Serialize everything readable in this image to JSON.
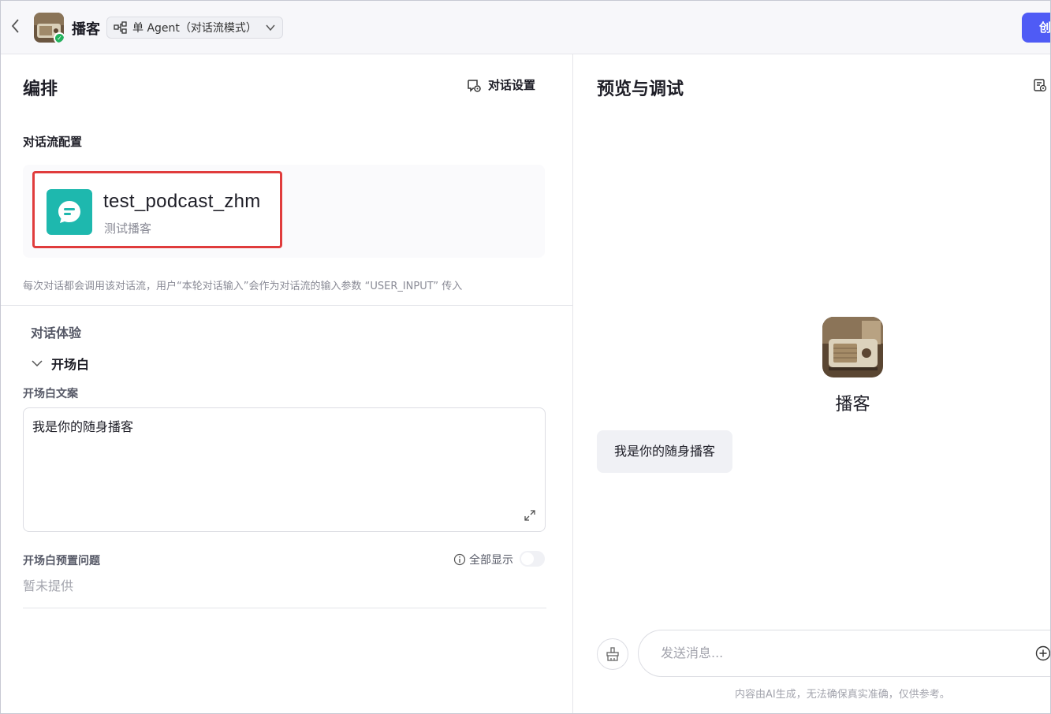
{
  "header": {
    "bot_name": "播客",
    "mode_label": "单 Agent（对话流模式）",
    "create_label": "创"
  },
  "left": {
    "title": "编排",
    "chat_settings_label": "对话设置",
    "flow_config_label": "对话流配置",
    "flow": {
      "name": "test_podcast_zhm",
      "description": "测试播客"
    },
    "flow_hint": "每次对话都会调用该对话流，用户“本轮对话输入”会作为对话流的输入参数 “USER_INPUT” 传入",
    "experience_label": "对话体验",
    "opening_label": "开场白",
    "opening_text_label": "开场白文案",
    "opening_text_value": "我是你的随身播客",
    "preset_label": "开场白预置问题",
    "show_all_label": "全部显示",
    "show_all_enabled": false,
    "preset_empty": "暂未提供"
  },
  "right": {
    "title": "预览与调试",
    "bot_name": "播客",
    "opening_bubble": "我是你的随身播客",
    "input_placeholder": "发送消息...",
    "disclaimer": "内容由AI生成，无法确保真实准确，仅供参考。"
  },
  "colors": {
    "accent": "#4f5bf5",
    "flow_icon_bg": "#1eb8ae",
    "highlight_border": "#e03c3c",
    "status_ok": "#22b35e"
  }
}
